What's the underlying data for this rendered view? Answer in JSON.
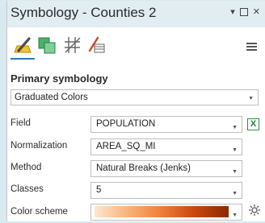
{
  "window": {
    "title": "Symbology - Counties 2",
    "controls": [
      "▾",
      "□",
      "✕"
    ]
  },
  "toolbar": {
    "tools": [
      {
        "name": "primary-symbology",
        "icon": "pencil-polygon-icon",
        "active": true
      },
      {
        "name": "vary-symbology",
        "icon": "layered-polygons-icon",
        "active": false
      },
      {
        "name": "symbol-layer-drawing",
        "icon": "hatch-grid-icon",
        "active": false
      },
      {
        "name": "label-classes",
        "icon": "pen-table-icon",
        "active": false
      }
    ],
    "menu_icon": "hamburger-menu-icon"
  },
  "primary_symbology": {
    "heading": "Primary symbology",
    "renderer": "Graduated Colors"
  },
  "fields": {
    "field": {
      "label": "Field",
      "value": "POPULATION"
    },
    "normalization": {
      "label": "Normalization",
      "value": "AREA_SQ_MI"
    },
    "method": {
      "label": "Method",
      "value": "Natural Breaks (Jenks)"
    },
    "classes": {
      "label": "Classes",
      "value": "5"
    },
    "color_scheme": {
      "label": "Color scheme",
      "ramp_colors": [
        "#fde6cf",
        "#f9b37a",
        "#ee7e3a",
        "#c7470f",
        "#8a2a04"
      ]
    }
  },
  "expression_icon": "expression-x-icon",
  "gear_icon": "gear-icon"
}
